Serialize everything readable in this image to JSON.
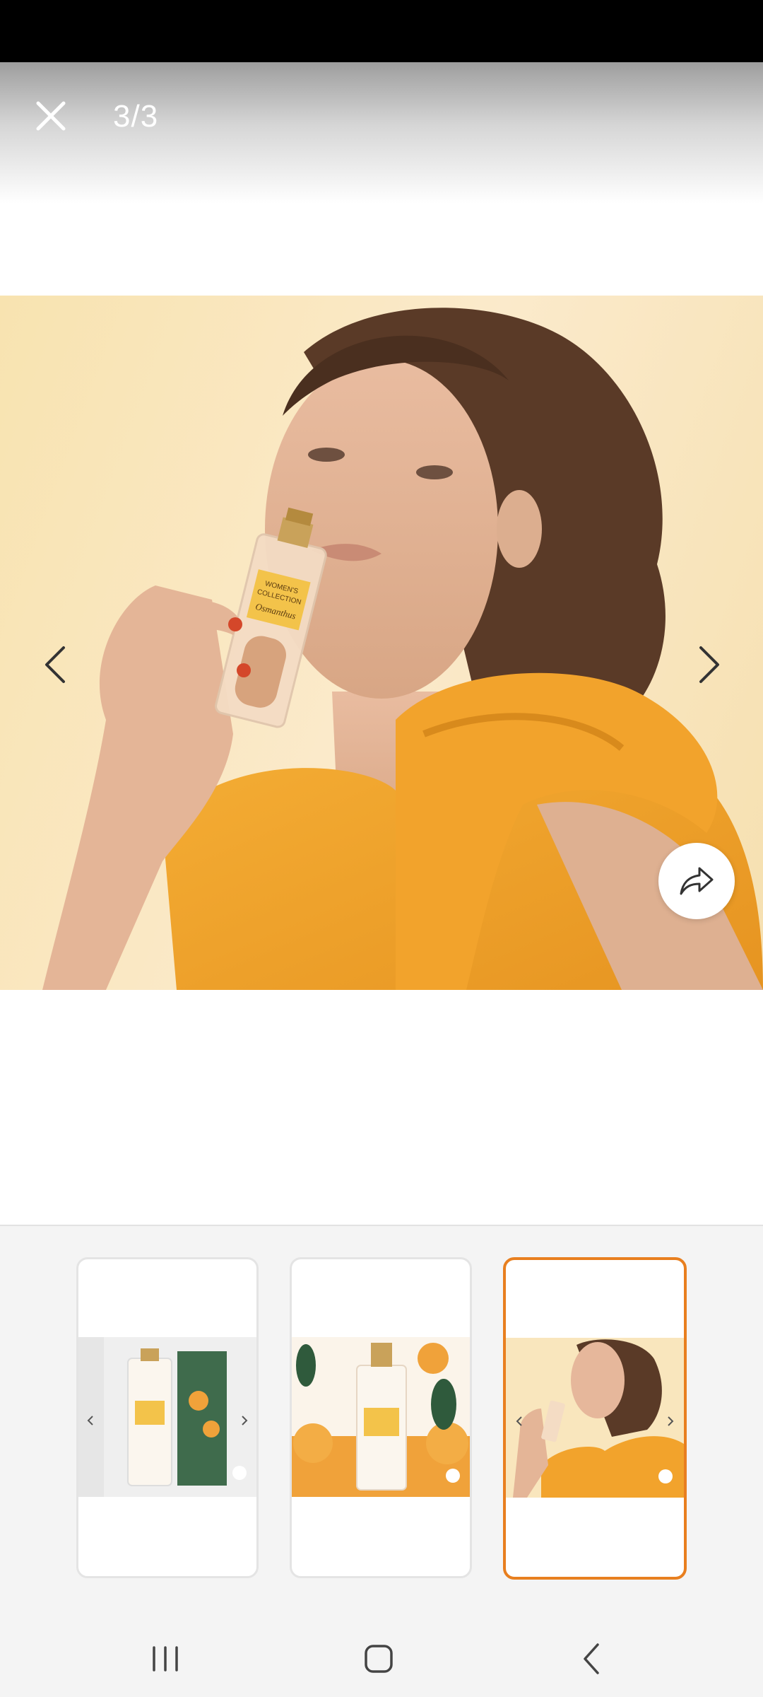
{
  "viewer": {
    "counter": "3/3"
  },
  "thumbnails": [
    {
      "name": "thumbnail-1",
      "selected": false
    },
    {
      "name": "thumbnail-2",
      "selected": false
    },
    {
      "name": "thumbnail-3",
      "selected": true
    }
  ],
  "product": {
    "brand_line1": "WOMEN'S",
    "brand_line2": "COLLECTION",
    "script_name": "Osmanthus"
  },
  "colors": {
    "accent_selected": "#e87f1f",
    "dress": "#f2a32c",
    "background": "#fbeacb"
  },
  "icons": {
    "close": "close-icon",
    "prev": "chevron-left-icon",
    "next": "chevron-right-icon",
    "share": "share-icon",
    "recents": "recents-icon",
    "home": "home-icon",
    "back": "back-icon"
  }
}
